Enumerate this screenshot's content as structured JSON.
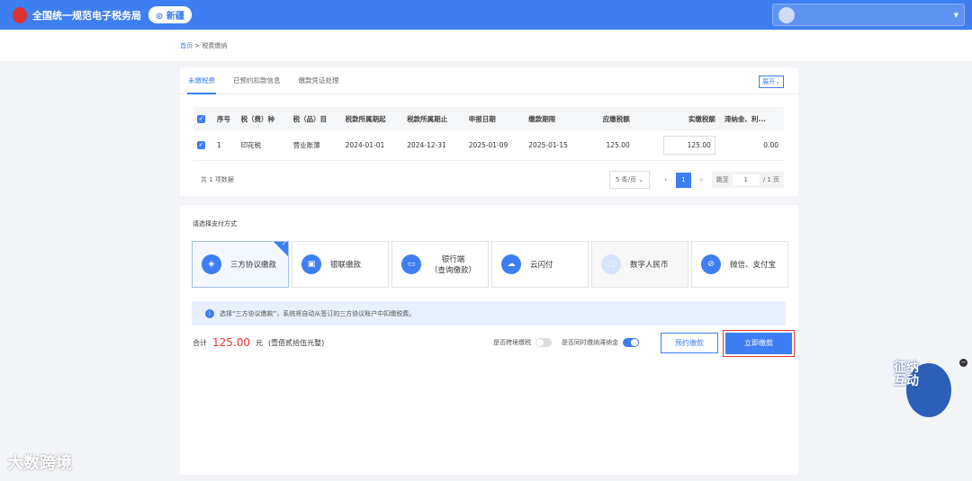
{
  "header": {
    "title": "全国统一规范电子税务局",
    "region": "新疆"
  },
  "breadcrumb": {
    "home": "首页",
    "sep": ">",
    "current": "税费缴纳"
  },
  "tabs": [
    "未缴税费",
    "已预约扣款信息",
    "缴款凭证处理"
  ],
  "expand": "展开⌄",
  "table": {
    "headers": [
      "序号",
      "税（费）种",
      "税（品）目",
      "税款所属期起",
      "税款所属期止",
      "申报日期",
      "缴款期限",
      "应缴税额",
      "实缴税额",
      "滞纳金、利..."
    ],
    "rows": [
      [
        "1",
        "印花税",
        "营业账簿",
        "2024-01-01",
        "2024-12-31",
        "2025-01-09",
        "2025-01-15",
        "125.00",
        "125.00",
        "0.00"
      ]
    ]
  },
  "pager": {
    "total": "共 1 项数据",
    "page_size": "5 条/页 ⌄",
    "prev": "‹",
    "page": "1",
    "next": "›",
    "jump_label": "跳至",
    "jump_value": "1",
    "pages": "/ 1 页"
  },
  "payment": {
    "label": "请选择支付方式",
    "methods": [
      "三方协议缴款",
      "银联缴款",
      "银行端\n（查询缴款）",
      "云闪付",
      "数字人民币",
      "微信、支付宝"
    ],
    "info": "选择“三方协议缴款”，系统将自动从签订的三方协议账户中扣缴税费。",
    "total_label": "合计",
    "total_value": "125.00",
    "unit": "元",
    "total_words": "(壹佰贰拾伍元整)",
    "opt1": "是否跨境缴税",
    "opt2": "是否同时缴纳滞纳金",
    "reserve": "预约缴款",
    "pay_now": "立即缴款"
  },
  "watermark": "大数跨境",
  "mascot": "征纳互动"
}
